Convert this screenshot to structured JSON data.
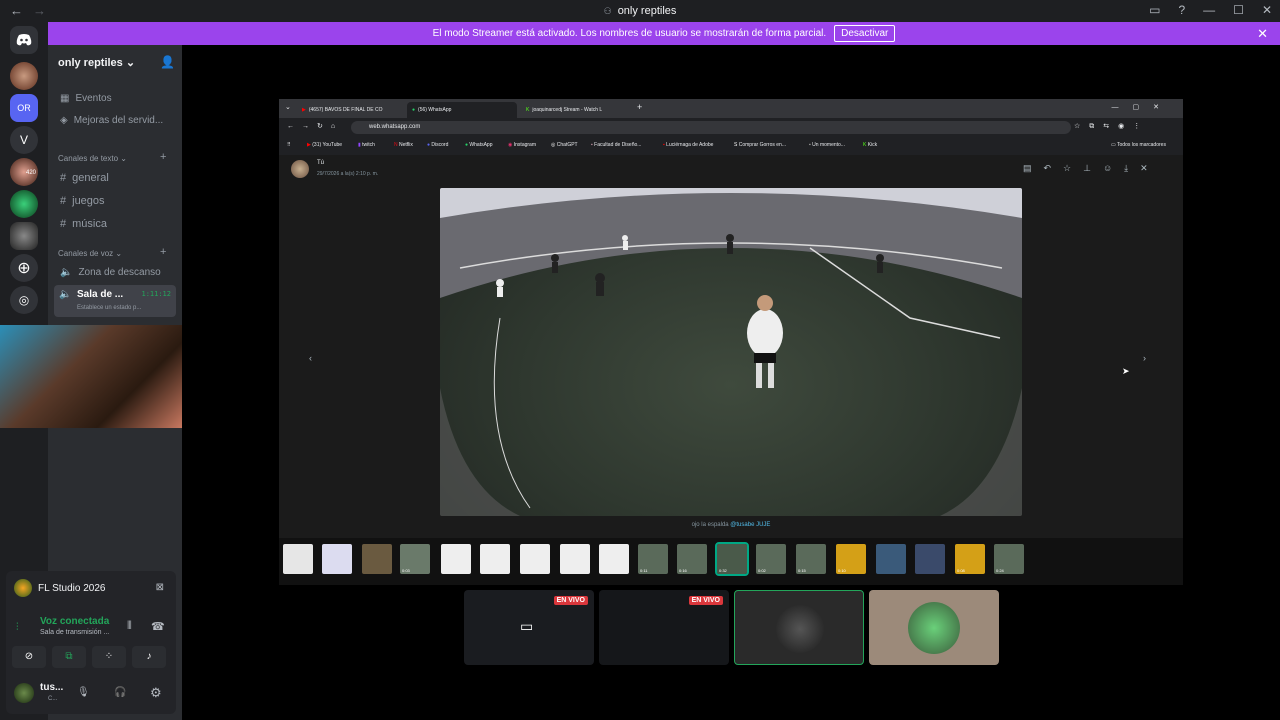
{
  "window": {
    "title": "only reptiles"
  },
  "banner": {
    "text": "El modo Streamer está activado. Los nombres de usuario se mostrarán de forma parcial.",
    "button": "Desactivar"
  },
  "guilds": {
    "items": [
      "OR",
      "V"
    ],
    "badge": "420"
  },
  "server": {
    "name": "only reptiles",
    "top_items": [
      "Eventos",
      "Mejoras del servid..."
    ],
    "text_category": "Canales de texto",
    "text_channels": [
      "general",
      "juegos",
      "música"
    ],
    "voice_category": "Canales de voz",
    "voice_channels": [
      "Zona de descanso"
    ],
    "active_voice": {
      "name": "Sala de ...",
      "time": "1:11:12",
      "status": "Establece un estado p..."
    }
  },
  "activity": {
    "name": "FL Studio 2026"
  },
  "voice_panel": {
    "status": "Voz conectada",
    "channel": "Sala de transmisión ..."
  },
  "user": {
    "name": "tus...",
    "status": "C..."
  },
  "browser": {
    "tabs": [
      "(4657) BAVOS DE FINAL DE CO",
      "(56) WhatsApp",
      "joaquinarcedj Stream - Watch L"
    ],
    "url": "web.whatsapp.com",
    "bookmarks": [
      "(31) YouTube",
      "twitch",
      "Netflix",
      "Discord",
      "WhatsApp",
      "Instagram",
      "ChatGPT",
      "Facultad de Diseño...",
      "Luciérnaga de Adobe",
      "Comprar Gorros en...",
      "Un momento...",
      "Kick"
    ],
    "bookmarks_all": "Todos los marcadores"
  },
  "whatsapp": {
    "sender": "Tú",
    "date": "29/7/2026 a la(s) 2:10 p. m.",
    "caption_pre": "ojo la espalda ",
    "caption_mention": "@tusabe JUJE"
  },
  "thumb_labels": [
    "0:03",
    "0:11",
    "0:16",
    "0:32",
    "0:02",
    "0:15",
    "0:10",
    "0:08",
    "0:24"
  ],
  "streams": {
    "live_label": "EN VIVO"
  },
  "colors": {
    "accent": "#9b44ec",
    "discord_bg": "#2b2d31",
    "green": "#23a55a",
    "live": "#da373c"
  }
}
